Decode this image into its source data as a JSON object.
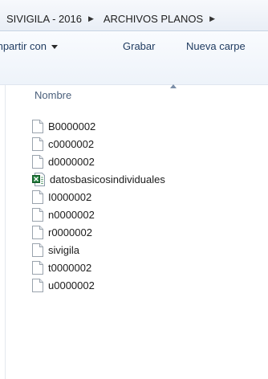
{
  "breadcrumb": {
    "items": [
      "SIVIGILA - 2016",
      "ARCHIVOS PLANOS"
    ]
  },
  "toolbar": {
    "share_label": "mpartir con",
    "burn_label": "Grabar",
    "new_folder_label": "Nueva carpe"
  },
  "columns": {
    "name": "Nombre"
  },
  "files": [
    {
      "name": "B0000002",
      "icon": "text-file-icon"
    },
    {
      "name": "c0000002",
      "icon": "text-file-icon"
    },
    {
      "name": "d0000002",
      "icon": "text-file-icon"
    },
    {
      "name": "datosbasicosindividuales",
      "icon": "excel-file-icon"
    },
    {
      "name": "I0000002",
      "icon": "text-file-icon"
    },
    {
      "name": "n0000002",
      "icon": "text-file-icon"
    },
    {
      "name": "r0000002",
      "icon": "text-file-icon"
    },
    {
      "name": "sivigila",
      "icon": "text-file-icon"
    },
    {
      "name": "t0000002",
      "icon": "text-file-icon"
    },
    {
      "name": "u0000002",
      "icon": "text-file-icon"
    }
  ],
  "colors": {
    "toolbar_text": "#1e3a5f",
    "header_text": "#4a5f7b",
    "excel_green": "#1f7a3a"
  }
}
